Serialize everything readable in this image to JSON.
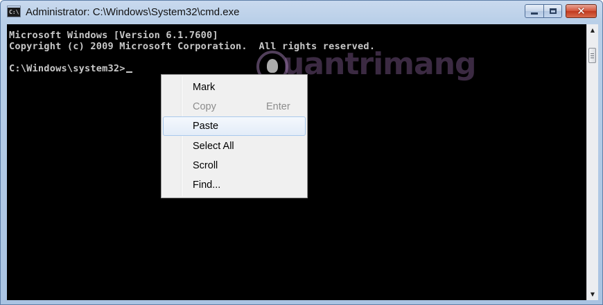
{
  "window": {
    "title": "Administrator: C:\\Windows\\System32\\cmd.exe",
    "icon_label": "C:\\"
  },
  "caption_buttons": {
    "minimize": "minimize-icon",
    "maximize": "maximize-icon",
    "close": "✕"
  },
  "console": {
    "lines": [
      "Microsoft Windows [Version 6.1.7600]",
      "Copyright (c) 2009 Microsoft Corporation.  All rights reserved.",
      "",
      "C:\\Windows\\system32>"
    ],
    "text_color": "#c8c8c8",
    "background": "#000000"
  },
  "watermark": {
    "text": "uantrimang"
  },
  "context_menu": {
    "items": [
      {
        "label": "Mark",
        "shortcut": "",
        "enabled": true,
        "highlighted": false
      },
      {
        "label": "Copy",
        "shortcut": "Enter",
        "enabled": false,
        "highlighted": false
      },
      {
        "label": "Paste",
        "shortcut": "",
        "enabled": true,
        "highlighted": true
      },
      {
        "label": "Select All",
        "shortcut": "",
        "enabled": true,
        "highlighted": false
      },
      {
        "label": "Scroll",
        "shortcut": "",
        "enabled": true,
        "highlighted": false
      },
      {
        "label": "Find...",
        "shortcut": "",
        "enabled": true,
        "highlighted": false
      }
    ]
  },
  "scrollbar": {
    "up_arrow": "▲",
    "down_arrow": "▼"
  }
}
